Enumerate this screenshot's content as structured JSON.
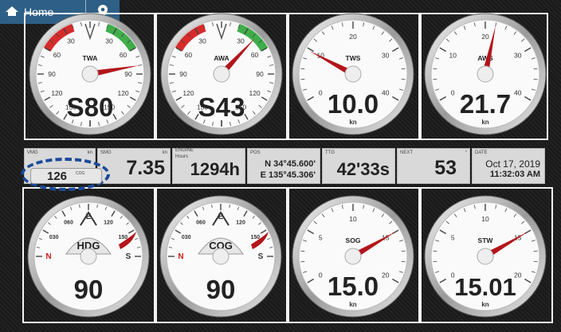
{
  "topbar": {
    "home_label": "Home"
  },
  "gauges_top": [
    {
      "name": "twa",
      "label": "TWA",
      "value": "S80",
      "unit": "",
      "type": "wind",
      "ticks": [
        "30",
        "60",
        "90",
        "120",
        "150",
        "30",
        "60",
        "90",
        "120",
        "150"
      ],
      "needle": 80
    },
    {
      "name": "awa",
      "label": "AWA",
      "value": "S43",
      "unit": "",
      "type": "wind",
      "ticks": [
        "30",
        "60",
        "90",
        "120",
        "150",
        "30",
        "60",
        "90",
        "120",
        "150"
      ],
      "needle": 43
    },
    {
      "name": "tws",
      "label": "TWS",
      "value": "10.0",
      "unit": "kn",
      "type": "speed",
      "ticks": [
        "0",
        "10",
        "20",
        "30",
        "40"
      ],
      "needle": -62
    },
    {
      "name": "aws",
      "label": "AWS",
      "value": "21.7",
      "unit": "kn",
      "type": "speed",
      "ticks": [
        "0",
        "10",
        "20",
        "30",
        "40"
      ],
      "needle": 12
    }
  ],
  "gauges_bottom": [
    {
      "name": "hdg",
      "label": "HDG",
      "value": "90",
      "unit": "",
      "type": "compass",
      "ticks": [
        "N",
        "030",
        "060",
        "E",
        "120",
        "150",
        "S"
      ],
      "needle": 0
    },
    {
      "name": "cog",
      "label": "COG",
      "value": "90",
      "unit": "",
      "type": "compass",
      "ticks": [
        "N",
        "030",
        "060",
        "E",
        "120",
        "150",
        "S"
      ],
      "needle": 0
    },
    {
      "name": "sog",
      "label": "SOG",
      "value": "15.0",
      "unit": "kn",
      "type": "speed2",
      "ticks": [
        "0",
        "5",
        "10",
        "15",
        "20"
      ],
      "needle": 60
    },
    {
      "name": "stw",
      "label": "STW",
      "value": "15.01",
      "unit": "kn",
      "type": "speed2",
      "ticks": [
        "0",
        "5",
        "10",
        "15",
        "20"
      ],
      "needle": 60
    }
  ],
  "infobar": {
    "vmg": {
      "label": "VMG",
      "unit": "kn",
      "value": "126",
      "sub": "COG"
    },
    "smg": {
      "label": "SMG",
      "unit": "kn",
      "value": "7.35"
    },
    "engine": {
      "label": "ENGINE",
      "sublabel": "Hours",
      "value": "1294h"
    },
    "pos": {
      "label": "POS",
      "lat": "N 34°45.600'",
      "lon": "E 135°45.306'"
    },
    "ttg": {
      "label": "TTG",
      "value": "42'33s"
    },
    "next": {
      "label": "NEXT",
      "value": "53"
    },
    "date": {
      "label": "DATE",
      "date": "Oct 17, 2019",
      "time": "11:32:03 AM"
    }
  },
  "colors": {
    "port": "#d52b2b",
    "starboard": "#3fae4a",
    "needle": "#b3151a",
    "accent": "#2e5f86",
    "highlight": "#1a4a9a"
  }
}
